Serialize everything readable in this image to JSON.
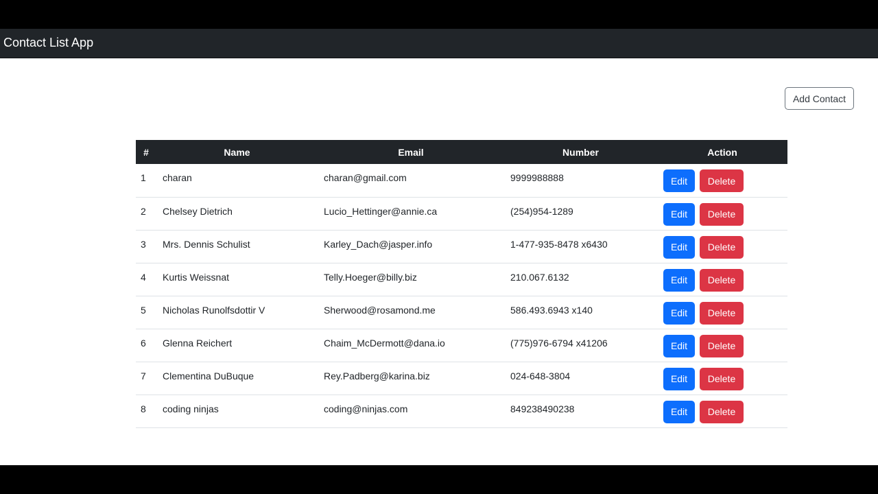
{
  "navbar": {
    "brand": "Contact List App",
    "background": "#212529"
  },
  "toolbar": {
    "add_label": "Add Contact"
  },
  "table": {
    "headers": {
      "index": "#",
      "name": "Name",
      "email": "Email",
      "number": "Number",
      "action": "Action"
    },
    "rows": [
      {
        "index": "1",
        "name": "charan",
        "email": "charan@gmail.com",
        "number": "9999988888",
        "edit": "Edit",
        "delete": "Delete"
      },
      {
        "index": "2",
        "name": "Chelsey Dietrich",
        "email": "Lucio_Hettinger@annie.ca",
        "number": "(254)954-1289",
        "edit": "Edit",
        "delete": "Delete"
      },
      {
        "index": "3",
        "name": "Mrs. Dennis Schulist",
        "email": "Karley_Dach@jasper.info",
        "number": "1-477-935-8478 x6430",
        "edit": "Edit",
        "delete": "Delete"
      },
      {
        "index": "4",
        "name": "Kurtis Weissnat",
        "email": "Telly.Hoeger@billy.biz",
        "number": "210.067.6132",
        "edit": "Edit",
        "delete": "Delete"
      },
      {
        "index": "5",
        "name": "Nicholas Runolfsdottir V",
        "email": "Sherwood@rosamond.me",
        "number": "586.493.6943 x140",
        "edit": "Edit",
        "delete": "Delete"
      },
      {
        "index": "6",
        "name": "Glenna Reichert",
        "email": "Chaim_McDermott@dana.io",
        "number": "(775)976-6794 x41206",
        "edit": "Edit",
        "delete": "Delete"
      },
      {
        "index": "7",
        "name": "Clementina DuBuque",
        "email": "Rey.Padberg@karina.biz",
        "number": "024-648-3804",
        "edit": "Edit",
        "delete": "Delete"
      },
      {
        "index": "8",
        "name": "coding ninjas",
        "email": "coding@ninjas.com",
        "number": "849238490238",
        "edit": "Edit",
        "delete": "Delete"
      }
    ]
  },
  "colors": {
    "edit_button": "#0d6efd",
    "delete_button": "#dc3545",
    "header_background": "#212529"
  }
}
